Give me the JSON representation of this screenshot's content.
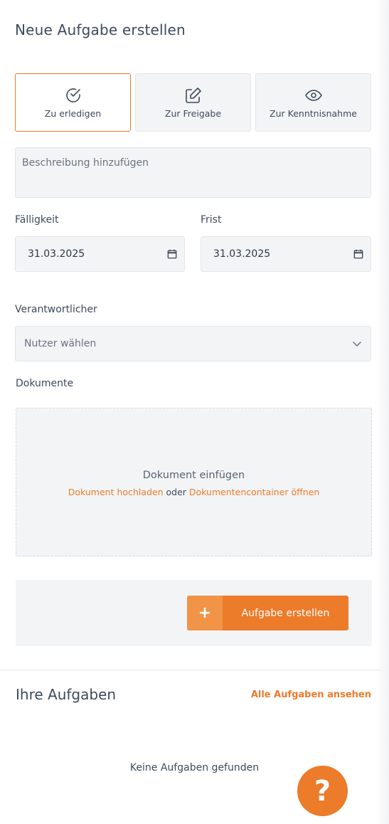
{
  "page_title": "Neue Aufgabe erstellen",
  "task_types": [
    {
      "label": "Zu erledigen",
      "icon": "check-circle-icon",
      "selected": true
    },
    {
      "label": "Zur Freigabe",
      "icon": "edit-icon",
      "selected": false
    },
    {
      "label": "Zur Kenntnisnahme",
      "icon": "eye-icon",
      "selected": false
    }
  ],
  "description": {
    "placeholder": "Beschreibung hinzufügen"
  },
  "due_date": {
    "label": "Fälligkeit",
    "value": "31.03.2025"
  },
  "deadline": {
    "label": "Frist",
    "value": "31.03.2025"
  },
  "responsible": {
    "label": "Verantwortlicher",
    "placeholder": "Nutzer wählen"
  },
  "documents": {
    "label": "Dokumente",
    "drop_title": "Dokument einfügen",
    "upload_link": "Dokument hochladen",
    "or_text": "oder",
    "container_link": "Dokumentencontainer öffnen"
  },
  "create_button": {
    "label": "Aufgabe erstellen",
    "icon": "plus-icon"
  },
  "tasks_section": {
    "title": "Ihre Aufgaben",
    "see_all": "Alle Aufgaben ansehen",
    "empty": "Keine Aufgaben gefunden"
  },
  "help": {
    "label": "?",
    "icon": "question-mark-icon"
  },
  "colors": {
    "accent": "#ec7b2a",
    "accent_light": "#f19448",
    "field_bg": "#f3f4f6",
    "text": "#3d4a5c"
  }
}
